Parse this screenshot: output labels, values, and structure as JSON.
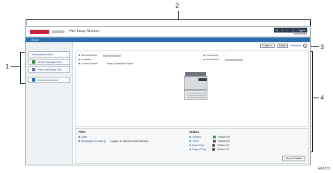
{
  "callouts": {
    "one": "1",
    "two": "2",
    "three": "3",
    "four": "4"
  },
  "header": {
    "app_title": "Web Image Monitor",
    "icons": [
      "Q",
      "?",
      "i",
      "→]"
    ],
    "login_label": "Logout",
    "user": "Administrator"
  },
  "breadcrumb": "- Home",
  "sidebar": {
    "items": [
      {
        "label": "Status/Information",
        "icon": "info-icon"
      },
      {
        "label": "Device Management",
        "icon": "gear-icon"
      },
      {
        "label": "Print Job/Stored File",
        "icon": "print-icon"
      },
      {
        "label": "Convenient Links",
        "icon": "link-icon"
      }
    ]
  },
  "toolbar": {
    "language": "English",
    "switch_label": "Switch",
    "refresh_label": "Refresh",
    "help": "?"
  },
  "info": {
    "device_name_label": "Device Name",
    "location_label": "Location",
    "control_panel_label": "Control Panel",
    "control_panel_value": ": Smart Operation Panel",
    "comment_label": "Comment",
    "host_name_label": "Host Name"
  },
  "alert": {
    "title": "Alert",
    "alert_label": "Alert",
    "messages_label": "Messages (Show[1])",
    "messages_value": "Logged in Machine Administrator"
  },
  "status": {
    "title": "Status",
    "rows": [
      {
        "label": "System",
        "value": "Status OK"
      },
      {
        "label": "Toner",
        "value": "Status OK"
      },
      {
        "label": "Input Tray",
        "value": "Status OK"
      },
      {
        "label": "Output Tray",
        "value": "Status OK"
      }
    ],
    "check_details": "Check Details"
  },
  "footer_code": "EAT375"
}
